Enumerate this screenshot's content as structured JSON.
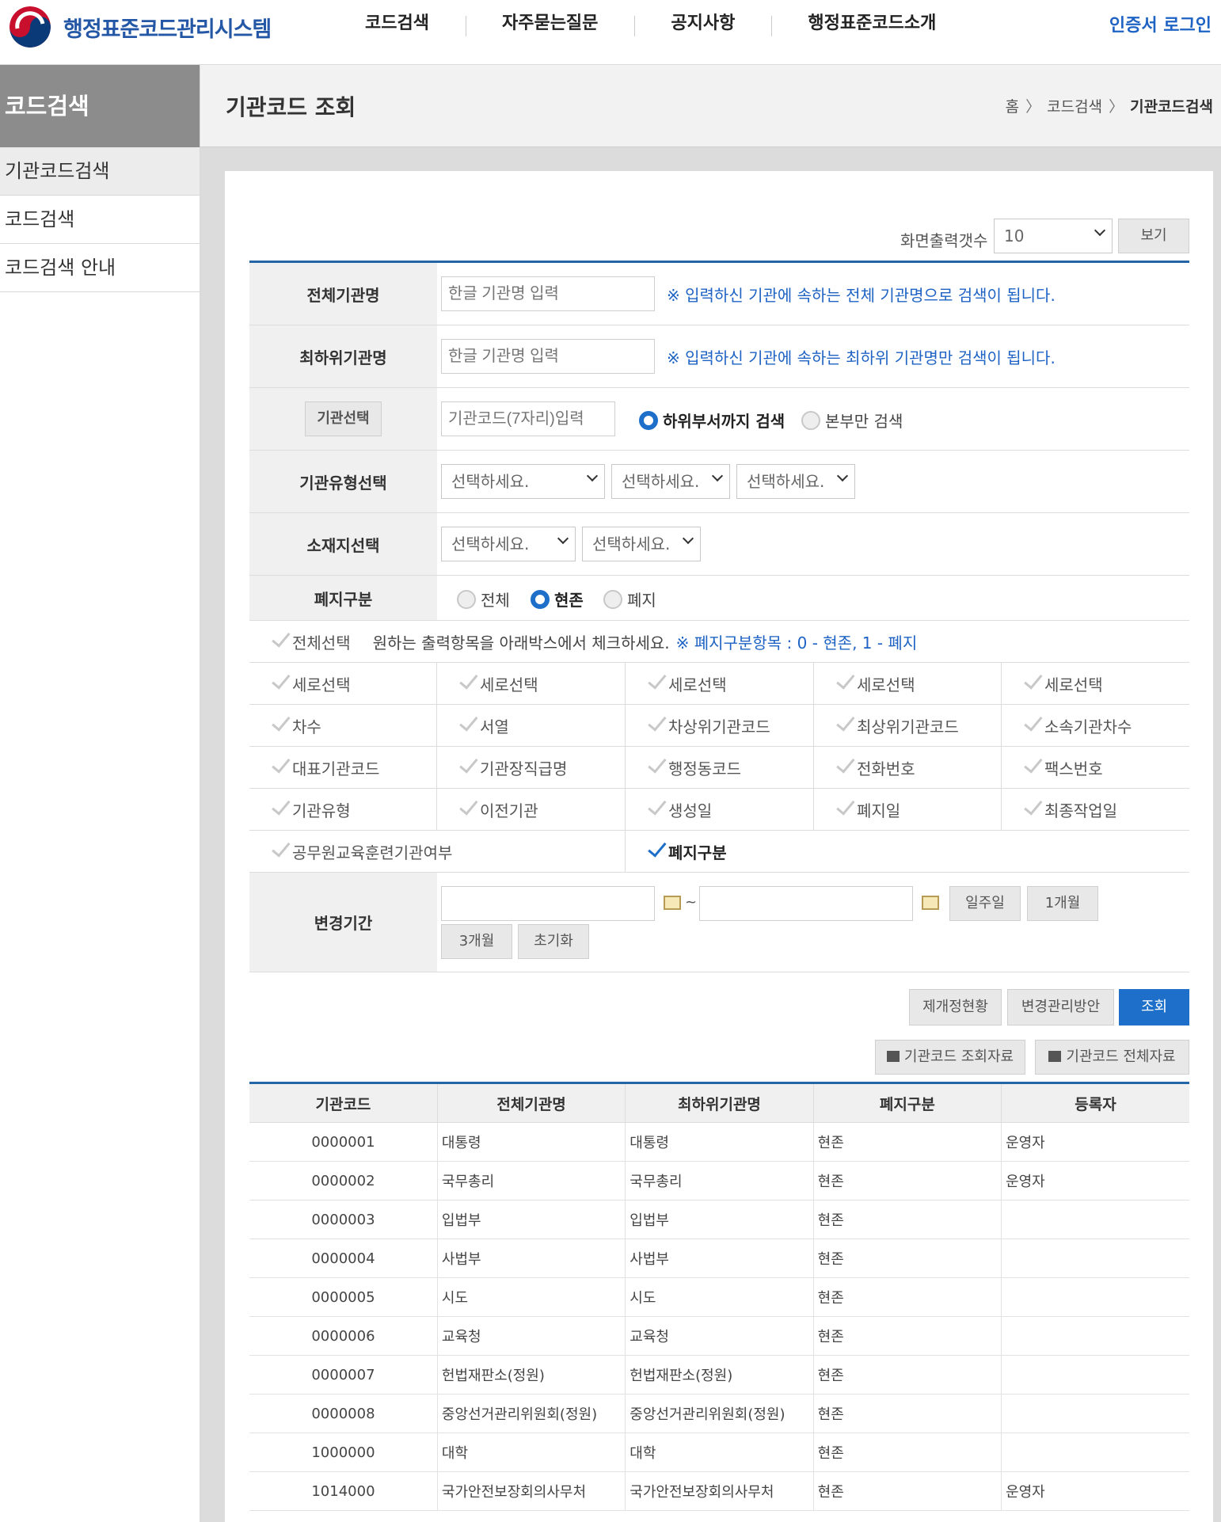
{
  "header": {
    "logo_text": "행정표준코드관리시스템",
    "nav": [
      "코드검색",
      "자주묻는질문",
      "공지사항",
      "행정표준코드소개"
    ],
    "login": "인증서 로그인"
  },
  "sidebar": {
    "title": "코드검색",
    "items": [
      {
        "label": "기관코드검색",
        "active": true
      },
      {
        "label": "코드검색"
      },
      {
        "label": "코드검색 안내"
      }
    ]
  },
  "page": {
    "title": "기관코드 조회",
    "breadcrumb": [
      "홈",
      "코드검색",
      "기관코드검색"
    ]
  },
  "display_count": {
    "label": "화면출력갯수",
    "value": "10",
    "button": "보기"
  },
  "form": {
    "full_name": {
      "label": "전체기관명",
      "placeholder": "한글 기관명 입력",
      "note": "※ 입력하신 기관에 속하는 전체 기관명으로 검색이 됩니다."
    },
    "lowest_name": {
      "label": "최하위기관명",
      "placeholder": "한글 기관명 입력",
      "note": "※ 입력하신 기관에 속하는 최하위 기관명만 검색이 됩니다."
    },
    "org_select": {
      "button": "기관선택",
      "placeholder": "기관코드(7자리)입력",
      "radio_sub": "하위부서까지 검색",
      "radio_main": "본부만 검색"
    },
    "org_type": {
      "label": "기관유형선택",
      "selects": [
        "선택하세요.",
        "선택하세요.",
        "선택하세요."
      ]
    },
    "location": {
      "label": "소재지선택",
      "selects": [
        "선택하세요.",
        "선택하세요."
      ]
    },
    "abolish": {
      "label": "폐지구분",
      "options": [
        "전체",
        "현존",
        "폐지"
      ],
      "selected": "현존"
    },
    "columns": {
      "select_all": "전체선택",
      "instruction": "원하는 출력항목을 아래박스에서 체크하세요.",
      "note": "※ 폐지구분항목 : 0 - 현존, 1 - 폐지",
      "rows": [
        [
          "세로선택",
          "세로선택",
          "세로선택",
          "세로선택",
          "세로선택"
        ],
        [
          "차수",
          "서열",
          "차상위기관코드",
          "최상위기관코드",
          "소속기관차수"
        ],
        [
          "대표기관코드",
          "기관장직급명",
          "행정동코드",
          "전화번호",
          "팩스번호"
        ],
        [
          "기관유형",
          "이전기관",
          "생성일",
          "폐지일",
          "최종작업일"
        ]
      ],
      "last_row": [
        "공무원교육훈련기관여부",
        "폐지구분"
      ]
    },
    "period": {
      "label": "변경기간",
      "tilde": "~",
      "buttons": [
        "일주일",
        "1개월",
        "3개월",
        "초기화"
      ]
    }
  },
  "actions": {
    "revision_status": "제개정현황",
    "change_plan": "변경관리방안",
    "search": "조회",
    "download_query": "기관코드 조회자료",
    "download_all": "기관코드 전체자료"
  },
  "table": {
    "headers": [
      "기관코드",
      "전체기관명",
      "최하위기관명",
      "폐지구분",
      "등록자"
    ],
    "rows": [
      [
        "0000001",
        "대통령",
        "대통령",
        "현존",
        "운영자"
      ],
      [
        "0000002",
        "국무총리",
        "국무총리",
        "현존",
        "운영자"
      ],
      [
        "0000003",
        "입법부",
        "입법부",
        "현존",
        ""
      ],
      [
        "0000004",
        "사법부",
        "사법부",
        "현존",
        ""
      ],
      [
        "0000005",
        "시도",
        "시도",
        "현존",
        ""
      ],
      [
        "0000006",
        "교육청",
        "교육청",
        "현존",
        ""
      ],
      [
        "0000007",
        "헌법재판소(정원)",
        "헌법재판소(정원)",
        "현존",
        ""
      ],
      [
        "0000008",
        "중앙선거관리위원회(정원)",
        "중앙선거관리위원회(정원)",
        "현존",
        ""
      ],
      [
        "1000000",
        "대학",
        "대학",
        "현존",
        ""
      ],
      [
        "1014000",
        "국가안전보장회의사무처",
        "국가안전보장회의사무처",
        "현존",
        "운영자"
      ]
    ]
  },
  "colors": {
    "accent_blue": "#1d6fc9",
    "header_rule": "#2465a8",
    "sidebar_title_bg": "#8c8c8c"
  }
}
